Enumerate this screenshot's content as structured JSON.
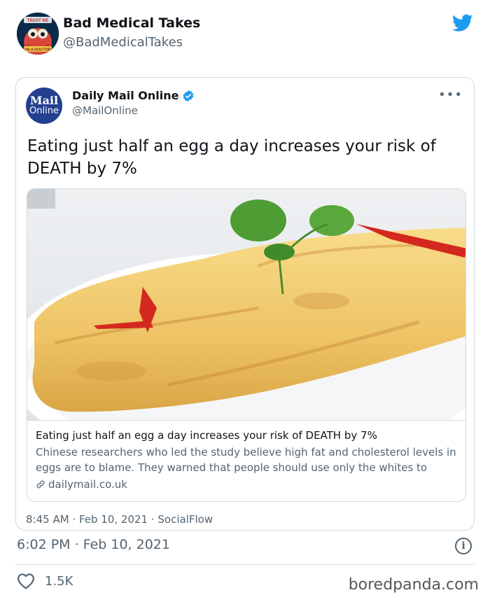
{
  "tweet": {
    "author_name": "Bad Medical Takes",
    "author_handle": "@BadMedicalTakes",
    "avatar_caption_top": "TRUST ME",
    "avatar_caption_bottom": "I'M A DOCTOR",
    "timestamp": "6:02 PM · Feb 10, 2021",
    "like_count": "1.5K"
  },
  "quoted": {
    "name": "Daily Mail Online",
    "handle": "@MailOnline",
    "avatar_line1": "Mail",
    "avatar_line2": "Online",
    "text": "Eating just half an egg a day increases your risk of DEATH by 7%",
    "footer": "8:45 AM · Feb 10, 2021 · SocialFlow",
    "link_card": {
      "title": "Eating just half an egg a day increases your risk of DEATH by 7%",
      "description": "Chinese researchers who led the study believe high fat and cholesterol levels in eggs are to blame. They warned that people should use only the whites to lower ...",
      "domain": "dailymail.co.uk",
      "image_subject": "omelette with cilantro and red chili on a white plate"
    }
  },
  "watermark": "boredpanda.com",
  "icons": [
    "twitter-bird-icon",
    "verified-badge-icon",
    "more-icon",
    "link-icon",
    "info-icon",
    "heart-icon"
  ],
  "colors": {
    "twitter_blue": "#1d9bf0",
    "text": "#0f1419",
    "muted": "#536471",
    "border": "#cfd9de",
    "mail_blue": "#23408f"
  }
}
